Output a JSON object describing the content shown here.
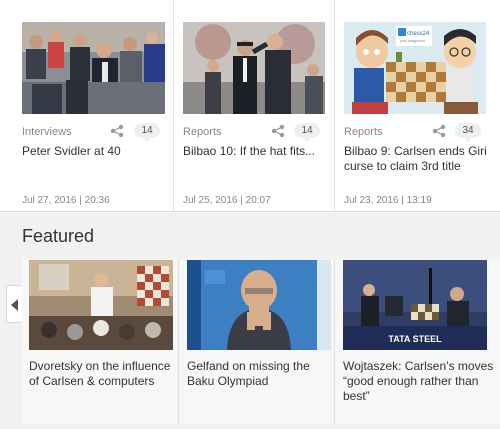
{
  "recent_articles": [
    {
      "category": "Interviews",
      "comments": "14",
      "title": "Peter Svidler at 40",
      "date": "Jul 27, 2016 | 20:36"
    },
    {
      "category": "Reports",
      "comments": "14",
      "title": "Bilbao 10: If the hat fits...",
      "date": "Jul 25, 2016 | 20:07"
    },
    {
      "category": "Reports",
      "comments": "34",
      "title": "Bilbao 9: Carlsen ends Giri curse to claim 3rd title",
      "date": "Jul 23, 2016 | 13:19"
    }
  ],
  "cartoon_logo": {
    "line1": "chess24",
    "line2": "your playground"
  },
  "featured": {
    "heading": "Featured",
    "items": [
      {
        "title": "Dvoretsky on the influence of Carlsen & computers"
      },
      {
        "title": "Gelfand on missing the Baku Olympiad"
      },
      {
        "title": "Wojtaszek: Carlsen’s moves “good enough rather than best”"
      }
    ],
    "banner_text": "TATA STEEL"
  },
  "icons": {
    "share": "share-icon",
    "comments": "comment-bubble-icon",
    "prev": "chevron-left-icon"
  },
  "colors": {
    "page_bg": "#ffffff",
    "featured_bg": "#f1f1f1",
    "meta_text": "#888888",
    "title_text": "#333333"
  }
}
